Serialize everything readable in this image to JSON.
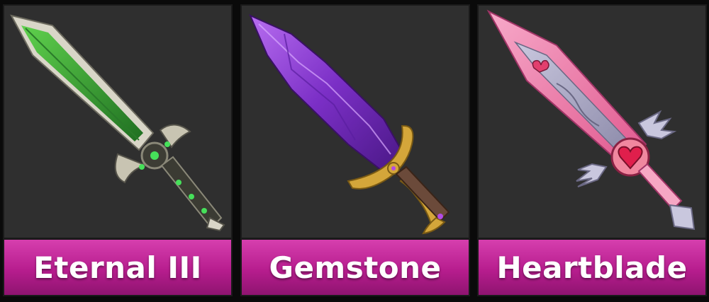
{
  "items": [
    {
      "name": "Eternal III",
      "icon": "green-sword-icon",
      "color": "#3fae3a"
    },
    {
      "name": "Gemstone",
      "icon": "purple-crystal-sword-icon",
      "color": "#8a3fd6"
    },
    {
      "name": "Heartblade",
      "icon": "pink-heart-sword-icon",
      "color": "#f28ab5"
    }
  ],
  "label_color": "#c42a9c"
}
